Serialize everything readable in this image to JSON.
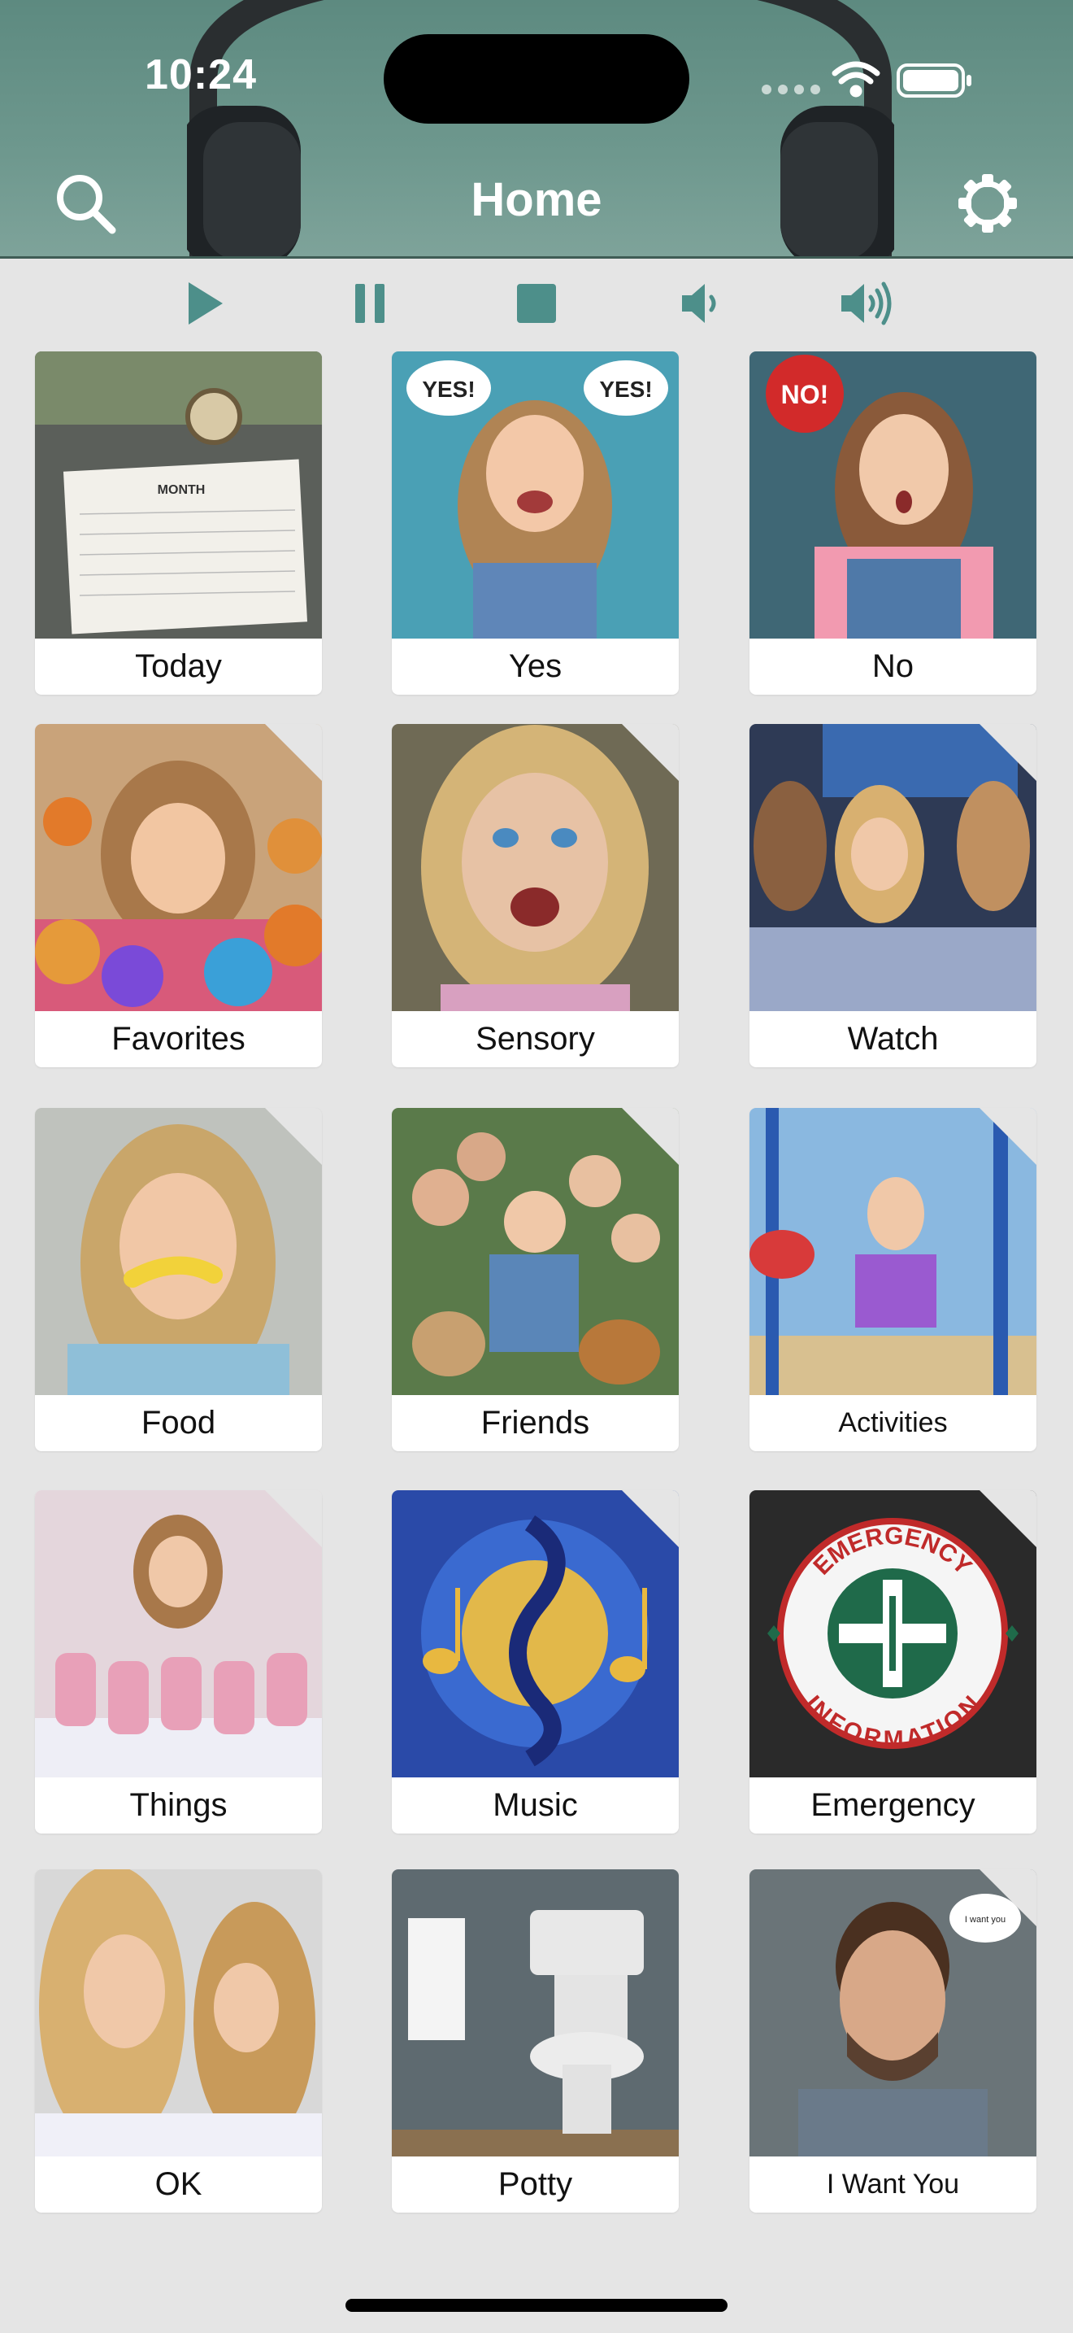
{
  "status_bar": {
    "time": "10:24"
  },
  "header": {
    "title": "Home"
  },
  "icons": {
    "search": "search-icon",
    "settings": "gear-icon",
    "play": "play-icon",
    "pause": "pause-icon",
    "stop": "stop-icon",
    "volume_down": "volume-down-icon",
    "volume_up": "volume-up-icon"
  },
  "colors": {
    "accent": "#4d8f8a",
    "header": "#6a948a",
    "background": "#e5e5e5"
  },
  "tiles": [
    {
      "label": "Today",
      "kind": "phrase"
    },
    {
      "label": "Yes",
      "kind": "phrase"
    },
    {
      "label": "No",
      "kind": "phrase"
    },
    {
      "label": "Favorites",
      "kind": "folder"
    },
    {
      "label": "Sensory",
      "kind": "folder"
    },
    {
      "label": "Watch",
      "kind": "folder"
    },
    {
      "label": "Food",
      "kind": "folder"
    },
    {
      "label": "Friends",
      "kind": "folder"
    },
    {
      "label": "Activities",
      "kind": "folder"
    },
    {
      "label": "Things",
      "kind": "folder"
    },
    {
      "label": "Music",
      "kind": "folder"
    },
    {
      "label": "Emergency",
      "kind": "folder"
    },
    {
      "label": "OK",
      "kind": "phrase"
    },
    {
      "label": "Potty",
      "kind": "phrase"
    },
    {
      "label": "I Want You",
      "kind": "folder"
    }
  ],
  "image_text": {
    "calendar": "MONTH",
    "yes_bubble": "YES!",
    "no_bubble": "NO!",
    "emergency_top": "EMERGENCY",
    "emergency_bottom": "INFORMATION",
    "want_bubble": "I want you"
  }
}
